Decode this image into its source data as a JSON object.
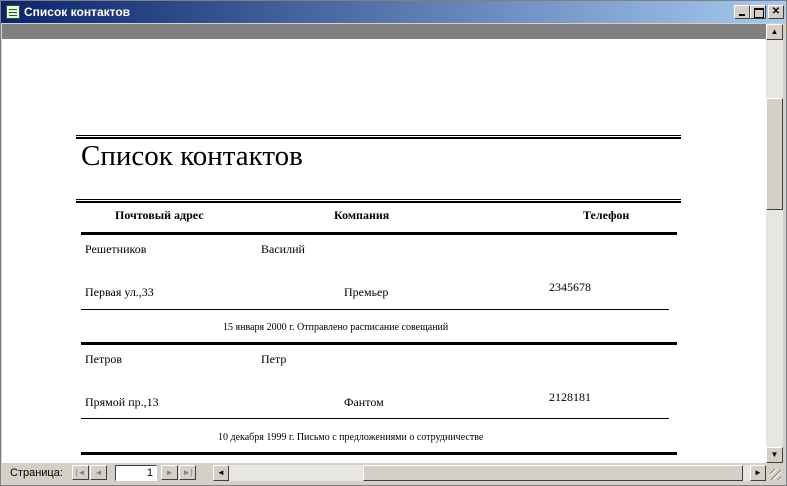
{
  "window": {
    "title": "Список контактов",
    "controls": {
      "minimize": "_",
      "maximize": "□",
      "close": "✕"
    }
  },
  "report": {
    "title": "Список контактов",
    "columns": [
      "Почтовый адрес",
      "Компания",
      "Телефон"
    ],
    "records": [
      {
        "last_name": "Решетников",
        "first_name": "Василий",
        "address": "Первая ул.,33",
        "company": "Премьер",
        "phone": "2345678",
        "note": "15 января 2000 г.  Отправлено расписание совещаний"
      },
      {
        "last_name": "Петров",
        "first_name": "Петр",
        "address": "Прямой пр.,13",
        "company": "Фантом",
        "phone": "2128181",
        "note": "10 декабря 1999 г.  Письмо с предложениями о сотрудничестве"
      }
    ]
  },
  "statusbar": {
    "page_label": "Страница:",
    "page_number": "1",
    "nav_icons": [
      "first-record-icon",
      "prev-record-icon",
      "next-record-icon",
      "last-record-icon"
    ]
  },
  "icons": {
    "window_icon": "report-icon",
    "scroll_up": "▲",
    "scroll_down": "▼",
    "scroll_left": "◄",
    "scroll_right": "►",
    "nav_first": "|◄",
    "nav_prev": "◄",
    "nav_next": "►",
    "nav_last": "►|"
  }
}
